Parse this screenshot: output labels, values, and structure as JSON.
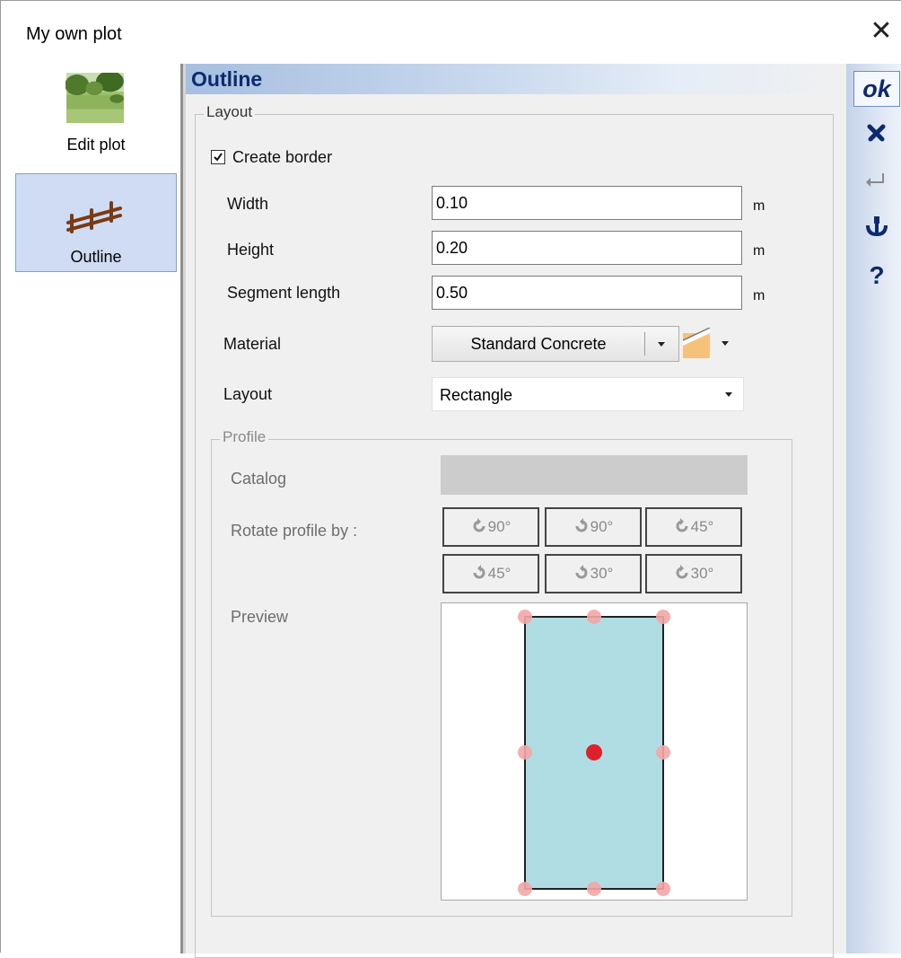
{
  "window": {
    "title": "My own plot",
    "close_glyph": "✕"
  },
  "sidebar": {
    "items": [
      {
        "label": "Edit plot",
        "icon": "plot-thumbnail-icon",
        "selected": false
      },
      {
        "label": "Outline",
        "icon": "fence-icon",
        "selected": true
      }
    ]
  },
  "panel": {
    "title": "Outline",
    "layout_group": {
      "legend": "Layout",
      "create_border": {
        "label": "Create border",
        "checked": true
      },
      "fields": [
        {
          "label": "Width",
          "value": "0.10",
          "unit": "m"
        },
        {
          "label": "Height",
          "value": "0.20",
          "unit": "m"
        },
        {
          "label": "Segment length",
          "value": "0.50",
          "unit": "m"
        }
      ],
      "material": {
        "label": "Material",
        "value": "Standard Concrete",
        "swatch_color": "#f6c27b"
      },
      "layout_select": {
        "label": "Layout",
        "value": "Rectangle"
      }
    },
    "profile_group": {
      "legend": "Profile",
      "catalog_label": "Catalog",
      "rotate_label": "Rotate profile by :",
      "rotate_buttons": [
        "90°",
        "90°",
        "45°",
        "45°",
        "30°",
        "30°"
      ],
      "preview_label": "Preview",
      "preview_fill": "#b0dde4",
      "handle_color": "#f4a6a6",
      "center_color": "#e0202a"
    }
  },
  "toolbar": {
    "ok_label": "ok",
    "items": [
      "cancel-icon",
      "enter-icon",
      "anchor-icon",
      "help-icon"
    ],
    "accent": "#0d2a6e"
  }
}
